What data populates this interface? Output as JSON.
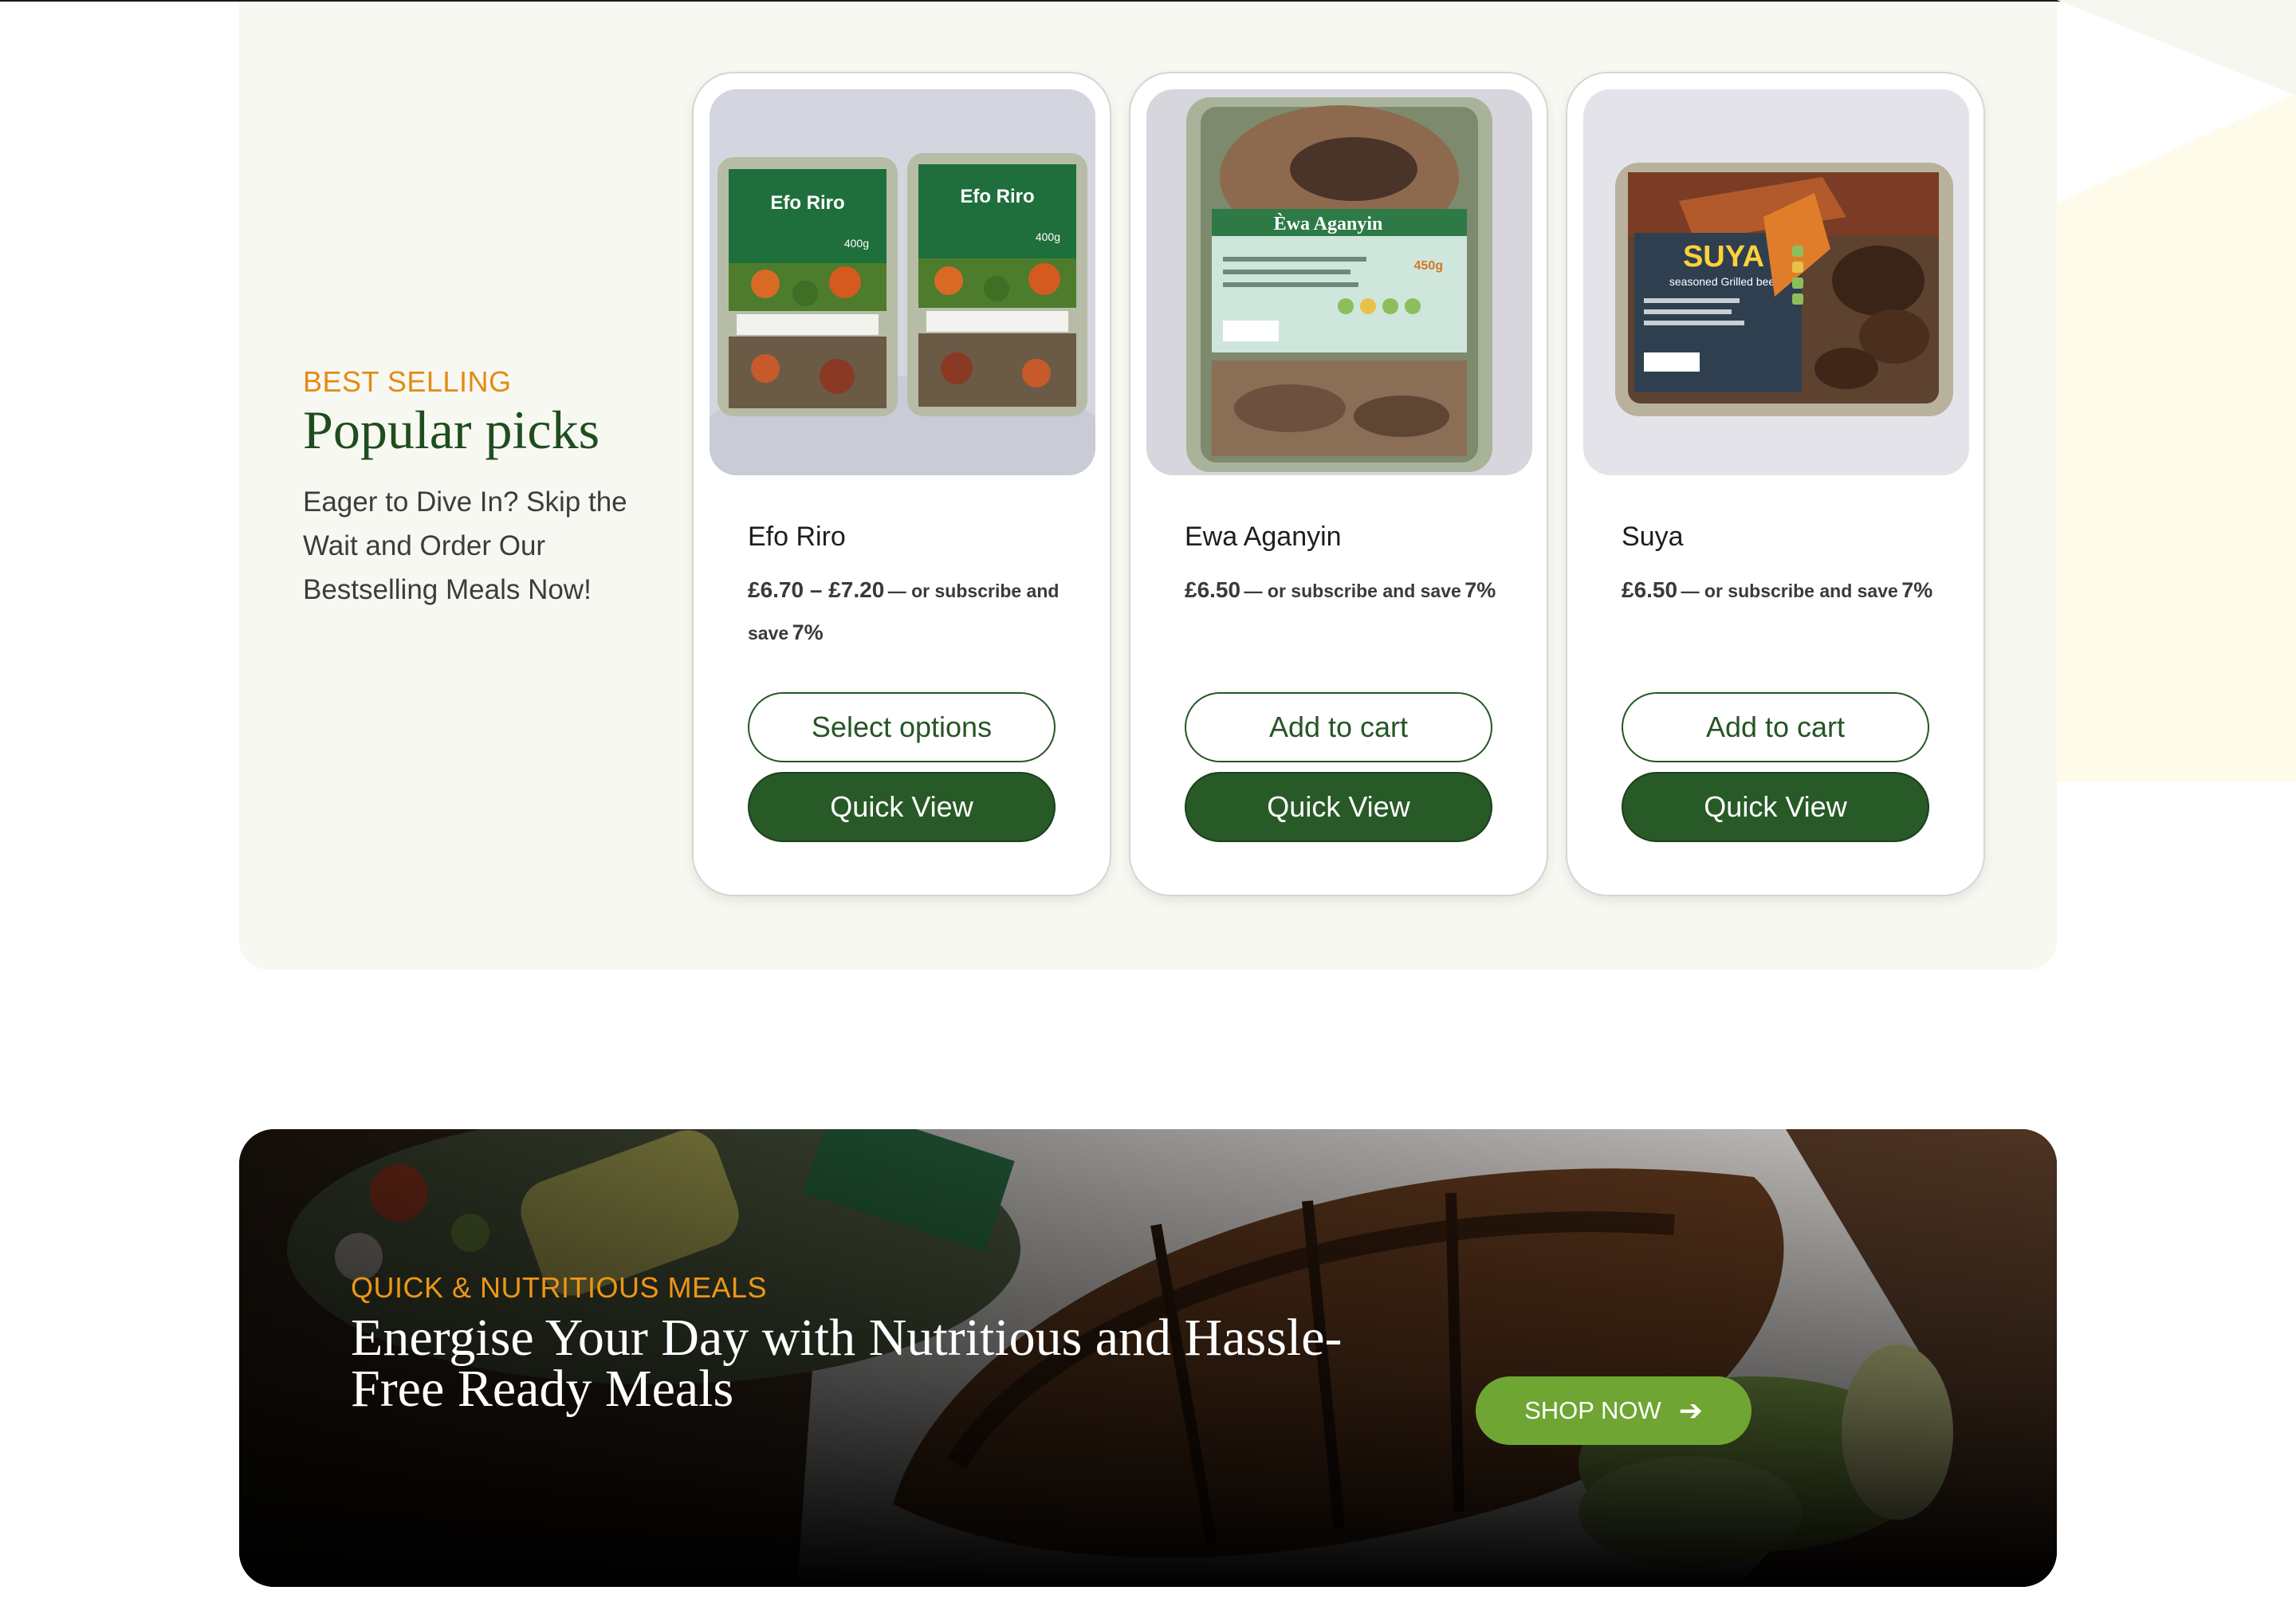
{
  "best_selling": {
    "eyebrow": "BEST SELLING",
    "heading": "Popular picks",
    "subtext": "Eager to Dive In? Skip the Wait and Order Our Bestselling Meals Now!"
  },
  "products": [
    {
      "name": "Efo Riro",
      "price": "£6.70 – £7.20",
      "subscribe_text": "— or subscribe and save",
      "discount": "7%",
      "primary_action": "Select options",
      "secondary_action": "Quick View",
      "package_label": "Efo Riro",
      "package_weight": "400g"
    },
    {
      "name": "Ewa Aganyin",
      "price": "£6.50",
      "subscribe_text": "— or subscribe and save",
      "discount": "7%",
      "primary_action": "Add to cart",
      "secondary_action": "Quick View",
      "package_label": "Èwa Aganyin",
      "package_weight": "450g"
    },
    {
      "name": "Suya",
      "price": "£6.50",
      "subscribe_text": "— or subscribe and save",
      "discount": "7%",
      "primary_action": "Add to cart",
      "secondary_action": "Quick View",
      "package_label": "SUYA",
      "package_sublabel": "seasoned Grilled beef"
    }
  ],
  "banner": {
    "eyebrow": "QUICK & NUTRITIOUS MEALS",
    "headline_line1": "Energise Your Day with Nutritious and Hassle-",
    "headline_line2": "Free Ready Meals",
    "cta": "SHOP NOW",
    "cta_icon": "arrow-right-icon"
  },
  "colors": {
    "brand_green": "#285a28",
    "accent_orange": "#e48a13",
    "cta_green": "#6fa532",
    "section_bg": "#f8f8f2"
  }
}
